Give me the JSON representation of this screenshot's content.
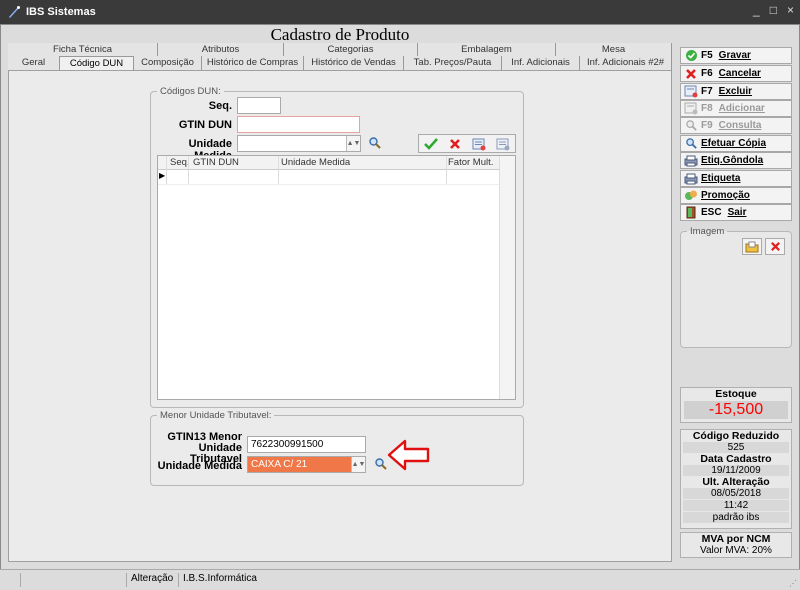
{
  "window": {
    "title": "IBS Sistemas",
    "controls": [
      "_",
      "□",
      "×"
    ]
  },
  "form": {
    "title": "Cadastro de Produto"
  },
  "tabs": {
    "row1": [
      "Ficha Técnica",
      "Atributos",
      "Categorias",
      "Embalagem",
      "Mesa"
    ],
    "row2": [
      "Geral",
      "Código DUN",
      "Composição",
      "Histórico de Compras",
      "Histórico de Vendas",
      "Tab. Preços/Pauta",
      "Inf. Adicionais",
      "Inf. Adicionais #2#"
    ],
    "active": "Código DUN"
  },
  "dun": {
    "legend": "Códigos DUN:",
    "seq_label": "Seq.",
    "seq_value": "",
    "gtin_label": "GTIN DUN",
    "gtin_value": "",
    "um_label": "Unidade Medida",
    "um_value": "",
    "grid_columns": [
      "Seq.",
      "GTIN DUN",
      "Unidade Medida",
      "Fator Mult."
    ],
    "row_marker": "▶"
  },
  "menor": {
    "legend": "Menor Unidade Tributavel:",
    "gtin13_label_line1": "GTIN13 Menor",
    "gtin13_label_line2": "Unidade Tributavel",
    "gtin13_value": "7622300991500",
    "um_label": "Unidade Medida",
    "um_value": "CAIXA C/ 21"
  },
  "actions": [
    {
      "key": "F5",
      "name": "Gravar",
      "icon": "check-circle-icon",
      "enabled": true
    },
    {
      "key": "F6",
      "name": "Cancelar",
      "icon": "red-x-icon",
      "enabled": true
    },
    {
      "key": "F7",
      "name": "Excluir",
      "icon": "delete-doc-icon",
      "enabled": true
    },
    {
      "key": "F8",
      "name": "Adicionar",
      "icon": "add-doc-icon",
      "enabled": false
    },
    {
      "key": "F9",
      "name": "Consulta",
      "icon": "search-icon",
      "enabled": false
    },
    {
      "key": "",
      "name": "Efetuar Cópia",
      "icon": "copy-icon",
      "enabled": true
    },
    {
      "key": "",
      "name": "Etiq.Gôndola",
      "icon": "printer-icon",
      "enabled": true
    },
    {
      "key": "",
      "name": "Etiqueta",
      "icon": "printer-icon",
      "enabled": true
    },
    {
      "key": "",
      "name": "Promoção",
      "icon": "promo-icon",
      "enabled": true
    },
    {
      "key": "ESC",
      "name": "Sair",
      "icon": "exit-icon",
      "enabled": true
    }
  ],
  "image_panel": {
    "legend": "Imagem"
  },
  "estoque": {
    "label": "Estoque",
    "value": "-15,500",
    "value_color": "#ff0000"
  },
  "info": {
    "codigo_reduzido_label": "Código Reduzido",
    "codigo_reduzido": "525",
    "data_cadastro_label": "Data Cadastro",
    "data_cadastro": "19/11/2009",
    "ult_alteracao_label": "Ult. Alteração",
    "ult_alteracao_data": "08/05/2018",
    "ult_alteracao_hora": "11:42",
    "ult_alteracao_user": "padrão ibs"
  },
  "mva": {
    "label": "MVA por NCM",
    "value": "Valor MVA: 20%"
  },
  "status": {
    "mode": "Alteração",
    "company": "I.B.S.Informática"
  }
}
